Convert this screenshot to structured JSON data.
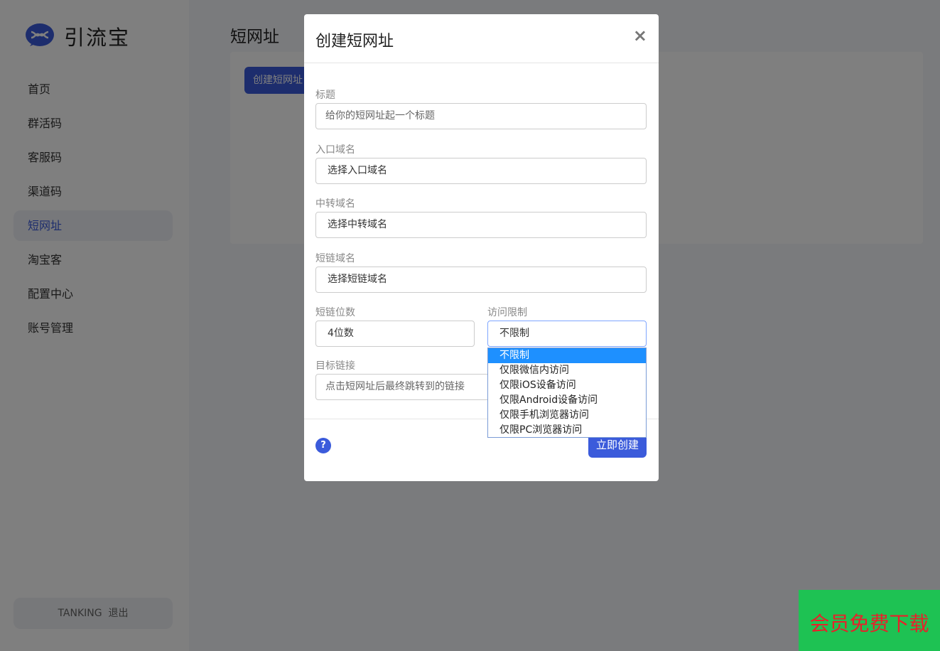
{
  "app": {
    "name": "引流宝"
  },
  "sidebar": {
    "items": [
      {
        "label": "首页"
      },
      {
        "label": "群活码"
      },
      {
        "label": "客服码"
      },
      {
        "label": "渠道码"
      },
      {
        "label": "短网址",
        "active": true
      },
      {
        "label": "淘宝客"
      },
      {
        "label": "配置中心"
      },
      {
        "label": "账号管理"
      }
    ],
    "user": {
      "name": "TANKING",
      "logout": "退出"
    }
  },
  "main": {
    "title": "短网址",
    "create_button": "创建短网址"
  },
  "modal": {
    "title": "创建短网址",
    "close": "×",
    "fields": {
      "title": {
        "label": "标题",
        "placeholder": "给你的短网址起一个标题"
      },
      "entry_domain": {
        "label": "入口域名",
        "value": "选择入口域名"
      },
      "relay_domain": {
        "label": "中转域名",
        "value": "选择中转域名"
      },
      "short_domain": {
        "label": "短链域名",
        "value": "选择短链域名"
      },
      "short_length": {
        "label": "短链位数",
        "value": "4位数"
      },
      "access_limit": {
        "label": "访问限制",
        "value": "不限制",
        "options": [
          "不限制",
          "仅限微信内访问",
          "仅限iOS设备访问",
          "仅限Android设备访问",
          "仅限手机浏览器访问",
          "仅限PC浏览器访问"
        ]
      },
      "target_url": {
        "label": "目标链接",
        "placeholder": "点击短网址后最终跳转到的链接"
      }
    },
    "help": "?",
    "submit": "立即创建"
  },
  "promo": {
    "text": "会员免费下载"
  },
  "colors": {
    "accent": "#3b5bdb",
    "selected_option": "#1e90ff",
    "promo_bg": "#1ec253",
    "promo_text": "#e8202a"
  }
}
